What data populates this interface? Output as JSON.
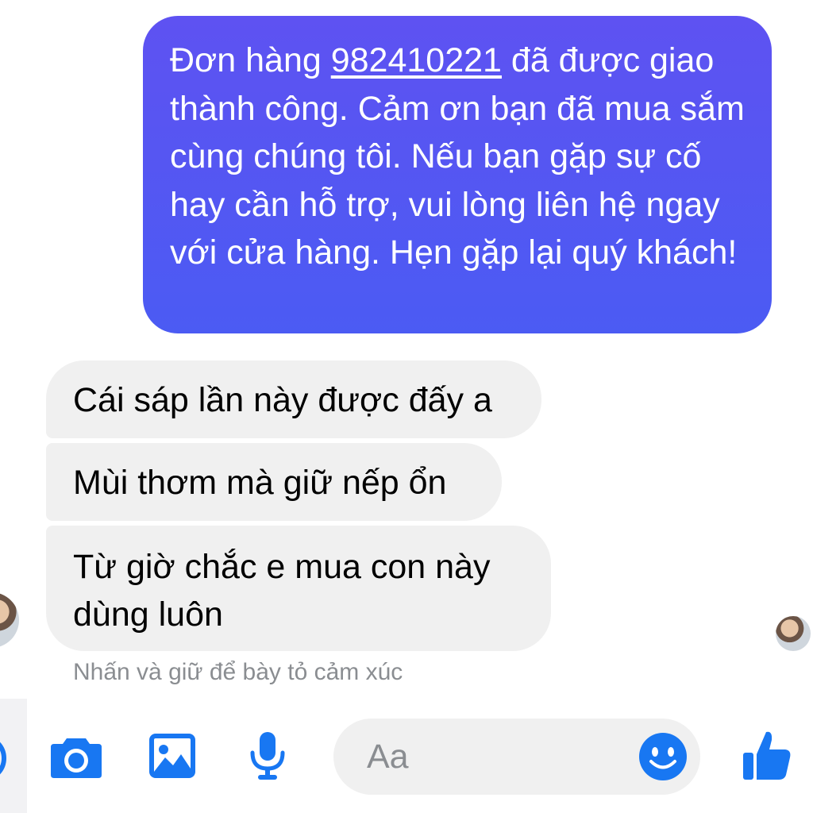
{
  "messages": {
    "sent": {
      "prefix": "Đơn hàng ",
      "order_id": "982410221",
      "body": " đã được giao thành công. Cảm ơn bạn đã mua sắm cùng chúng tôi. Nếu bạn gặp sự cố hay cần hỗ trợ, vui lòng liên hệ ngay với cửa hàng. Hẹn gặp lại quý khách!"
    },
    "received": [
      "Cái sáp lần này được đấy a",
      "Mùi thơm mà giữ nếp ổn",
      "Từ giờ chắc e mua con này dùng luôn"
    ]
  },
  "hint": "Nhấn và giữ để bày tỏ cảm xúc",
  "composer": {
    "placeholder": "Aa",
    "icons": [
      "more-icon",
      "camera-icon",
      "image-icon",
      "microphone-icon",
      "emoji-icon",
      "thumbs-up-icon"
    ]
  },
  "colors": {
    "accent": "#1877f2",
    "sent_bubble_top": "#5e52f2",
    "sent_bubble_bottom": "#4b5bf3",
    "received_bubble": "#f0f0f0",
    "hint_text": "#8a8d91"
  }
}
